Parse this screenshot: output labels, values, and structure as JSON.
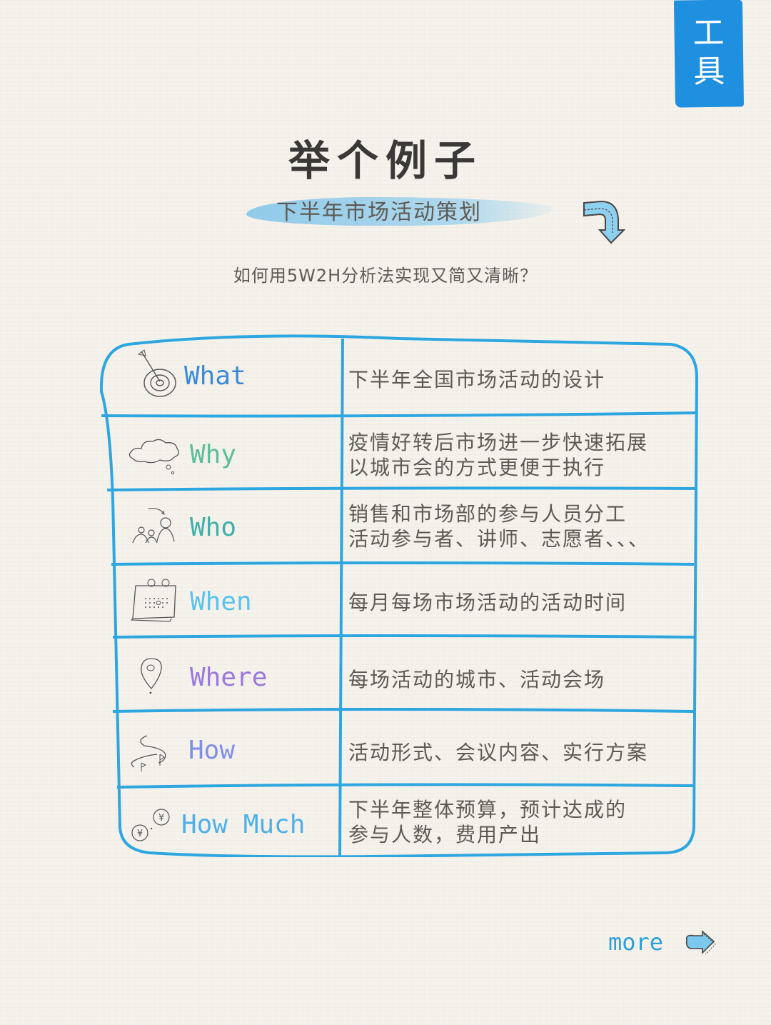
{
  "tag": {
    "chars": [
      "工",
      "具"
    ],
    "color": "#1f8fe0"
  },
  "title": "举个例子",
  "subtitle": "下半年市场活动策划",
  "question": "如何用5W2H分析法实现又简又清晰？",
  "table": {
    "border_color": "#2ea6e0",
    "rows": [
      {
        "label": "What",
        "color": "#3a8ad8",
        "icon": "target-icon",
        "desc": "下半年全国市场活动的设计"
      },
      {
        "label": "Why",
        "color": "#5cbf98",
        "icon": "thought-cloud-icon",
        "desc": "疫情好转后市场进一步快速拓展\n以城市会的方式更便于执行"
      },
      {
        "label": "Who",
        "color": "#3fb0a8",
        "icon": "people-icon",
        "desc": "销售和市场部的参与人员分工\n活动参与者、讲师、志愿者、、、"
      },
      {
        "label": "When",
        "color": "#5cc2ee",
        "icon": "calendar-icon",
        "desc": "每月每场市场活动的活动时间"
      },
      {
        "label": "Where",
        "color": "#9b78dc",
        "icon": "location-pin-icon",
        "desc": "每场活动的城市、活动会场"
      },
      {
        "label": "How",
        "color": "#7f8fe6",
        "icon": "route-flags-icon",
        "desc": "活动形式、会议内容、实行方案"
      },
      {
        "label": "How Much",
        "color": "#4fb0e8",
        "icon": "yuan-coins-icon",
        "desc": "下半年整体预算，预计达成的\n参与人数，费用产出"
      }
    ]
  },
  "more": {
    "label": "more",
    "icon": "arrow-right-icon"
  }
}
